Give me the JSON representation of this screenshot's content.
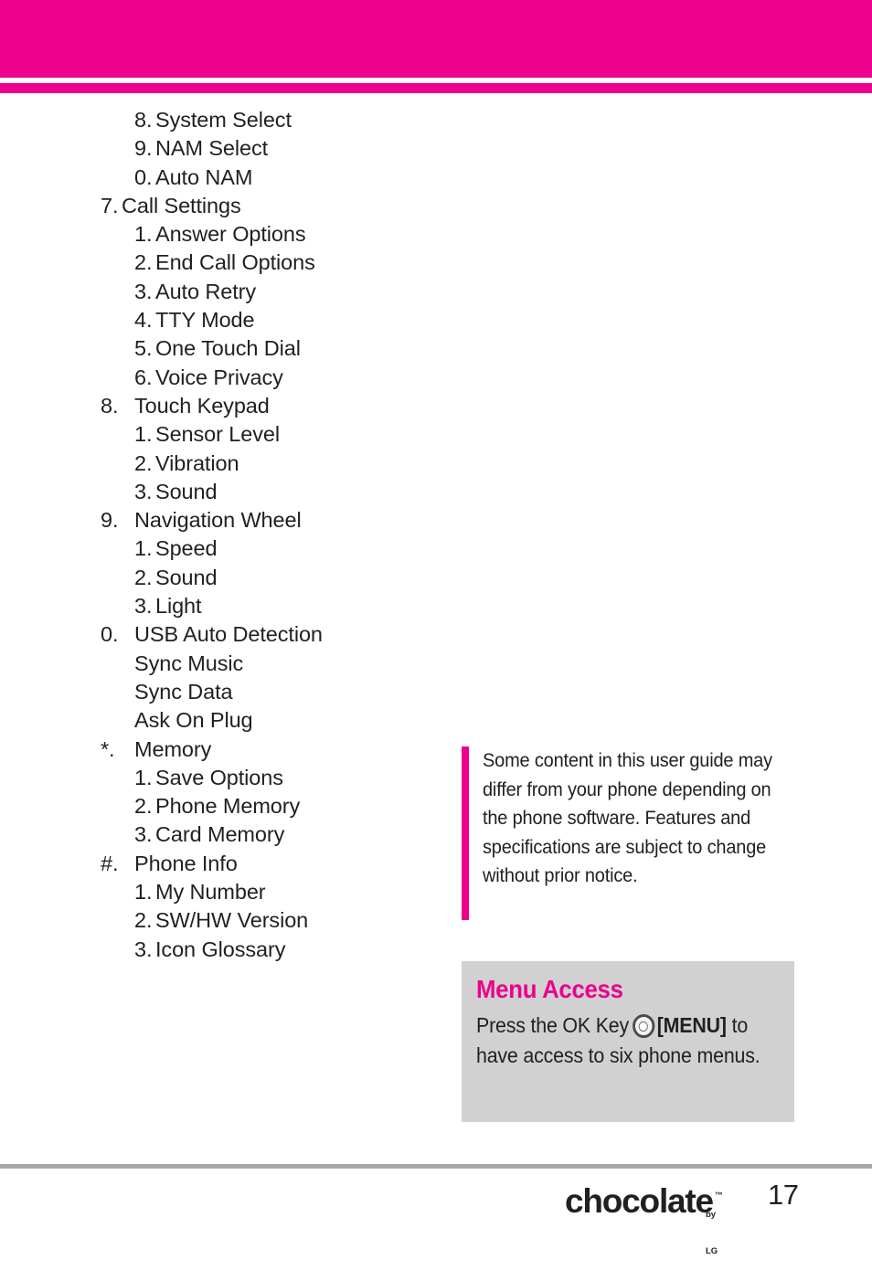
{
  "colors": {
    "brand_magenta": "#ec008c",
    "tip_box_gray": "#d1d1d1",
    "footer_rule_gray": "#a9a6a6",
    "text_black": "#231f20"
  },
  "menu_list": [
    {
      "number": "8.",
      "label": "System Select",
      "level": "sub"
    },
    {
      "number": "9.",
      "label": "NAM Select",
      "level": "sub"
    },
    {
      "number": "0.",
      "label": "Auto NAM",
      "level": "sub"
    },
    {
      "number": "7.",
      "label": "Call Settings",
      "level": "top"
    },
    {
      "number": "1.",
      "label": "Answer Options",
      "level": "sub"
    },
    {
      "number": "2.",
      "label": "End Call Options",
      "level": "sub"
    },
    {
      "number": "3.",
      "label": "Auto Retry",
      "level": "sub"
    },
    {
      "number": "4.",
      "label": "TTY Mode",
      "level": "sub"
    },
    {
      "number": "5.",
      "label": "One Touch Dial",
      "level": "sub"
    },
    {
      "number": "6.",
      "label": "Voice Privacy",
      "level": "sub"
    },
    {
      "number": "8.",
      "label": "Touch Keypad",
      "level": "top-wide"
    },
    {
      "number": "1.",
      "label": "Sensor Level",
      "level": "sub"
    },
    {
      "number": "2.",
      "label": "Vibration",
      "level": "sub"
    },
    {
      "number": "3.",
      "label": "Sound",
      "level": "sub"
    },
    {
      "number": "9.",
      "label": "Navigation Wheel",
      "level": "top-wide"
    },
    {
      "number": "1.",
      "label": "Speed",
      "level": "sub"
    },
    {
      "number": "2.",
      "label": "Sound",
      "level": "sub"
    },
    {
      "number": "3.",
      "label": "Light",
      "level": "sub"
    },
    {
      "number": "0.",
      "label": "USB Auto Detection",
      "level": "top-wide"
    },
    {
      "number": "",
      "label": "Sync Music",
      "level": "sub-plain"
    },
    {
      "number": "",
      "label": "Sync Data",
      "level": "sub-plain"
    },
    {
      "number": "",
      "label": "Ask On Plug",
      "level": "sub-plain"
    },
    {
      "number": "*.",
      "label": "Memory",
      "level": "top-wide"
    },
    {
      "number": "1.",
      "label": "Save Options",
      "level": "sub"
    },
    {
      "number": "2.",
      "label": "Phone Memory",
      "level": "sub"
    },
    {
      "number": "3.",
      "label": "Card Memory",
      "level": "sub"
    },
    {
      "number": "#.",
      "label": "Phone Info",
      "level": "top-wide"
    },
    {
      "number": "1.",
      "label": "My Number",
      "level": "sub"
    },
    {
      "number": "2.",
      "label": "SW/HW Version",
      "level": "sub"
    },
    {
      "number": "3.",
      "label": "Icon Glossary",
      "level": "sub"
    }
  ],
  "note": {
    "text": "Some content in this user guide may differ from your phone depending on the phone software. Features and specifications are subject to change without prior notice."
  },
  "tip": {
    "title": "Menu Access",
    "body_before_icon": "Press the OK Key",
    "icon_name": "ok-key-icon",
    "body_bold": "[MENU]",
    "body_after_icon": "to have access to six phone menus."
  },
  "footer": {
    "brand": "chocolate",
    "trademark": "™",
    "by_line": "by LG",
    "page_number": "17"
  }
}
